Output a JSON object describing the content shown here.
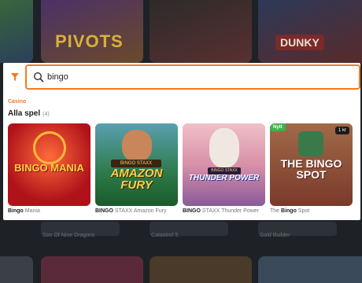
{
  "background": {
    "tiles": [
      "PIVOTS",
      "DUNKY"
    ],
    "captions": [
      "Son Of Nine Dragons",
      "Catastrof 5",
      "Gold Builder"
    ],
    "badge": ""
  },
  "search": {
    "value": "bingo",
    "placeholder": ""
  },
  "section": {
    "label": "Casino",
    "title": "Alla spel",
    "count": "(4)"
  },
  "games": [
    {
      "art_title": "BINGO MANIA",
      "caption_bold": "Bingo",
      "caption_rest": " Mania",
      "badge_left": "",
      "badge_right": ""
    },
    {
      "art_brand": "BINGO STAXX",
      "art_title": "AMAZON FURY",
      "caption_bold": "BINGO",
      "caption_rest": " STAXX Amazon Fury",
      "badge_left": "",
      "badge_right": ""
    },
    {
      "art_brand": "BINGO STAXX",
      "art_title": "THUNDER POWER",
      "caption_bold": "BINGO",
      "caption_rest": " STAXX Thunder Power",
      "badge_left": "",
      "badge_right": ""
    },
    {
      "art_title": "THE BINGO SPOT",
      "caption_pre": "The ",
      "caption_bold": "Bingo",
      "caption_rest": " Spot",
      "badge_left": "Nytt",
      "badge_right": "1 kr"
    }
  ],
  "colors": {
    "accent": "#f47b20",
    "new_badge": "#3ab54a"
  },
  "icons": {
    "filter": "filter-icon",
    "search": "search-icon"
  }
}
